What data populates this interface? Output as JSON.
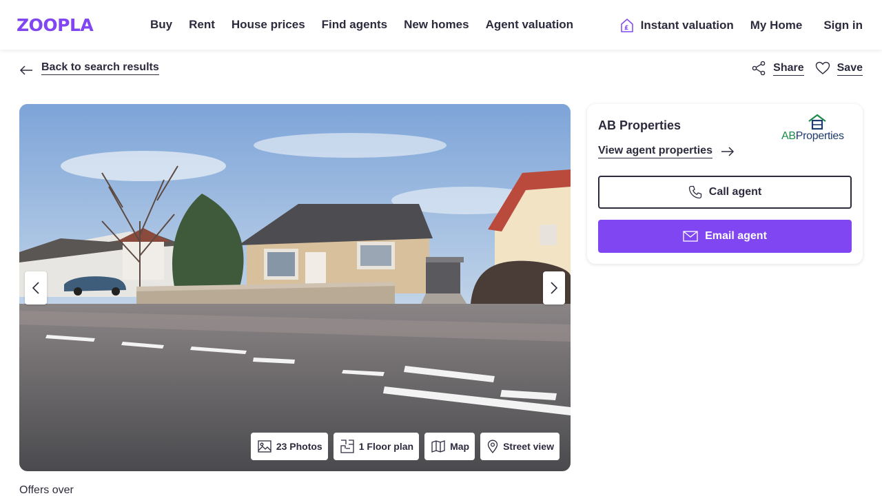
{
  "header": {
    "logo": "ZOOPLA",
    "nav": [
      "Buy",
      "Rent",
      "House prices",
      "Find agents",
      "New homes",
      "Agent valuation"
    ],
    "instant_valuation": "Instant valuation",
    "my_home": "My Home",
    "sign_in": "Sign in"
  },
  "subbar": {
    "back": "Back to search results",
    "share": "Share",
    "save": "Save"
  },
  "gallery": {
    "photos": "23 Photos",
    "floor_plan": "1 Floor plan",
    "map": "Map",
    "street_view": "Street view"
  },
  "agent": {
    "name": "AB Properties",
    "view_properties": "View agent properties",
    "logo_text_1": "AB",
    "logo_text_2": "Properties",
    "call": "Call agent",
    "email": "Email agent"
  },
  "listing": {
    "price_qualifier": "Offers over"
  },
  "colors": {
    "brand": "#8046f1",
    "text": "#2b2b3d"
  }
}
